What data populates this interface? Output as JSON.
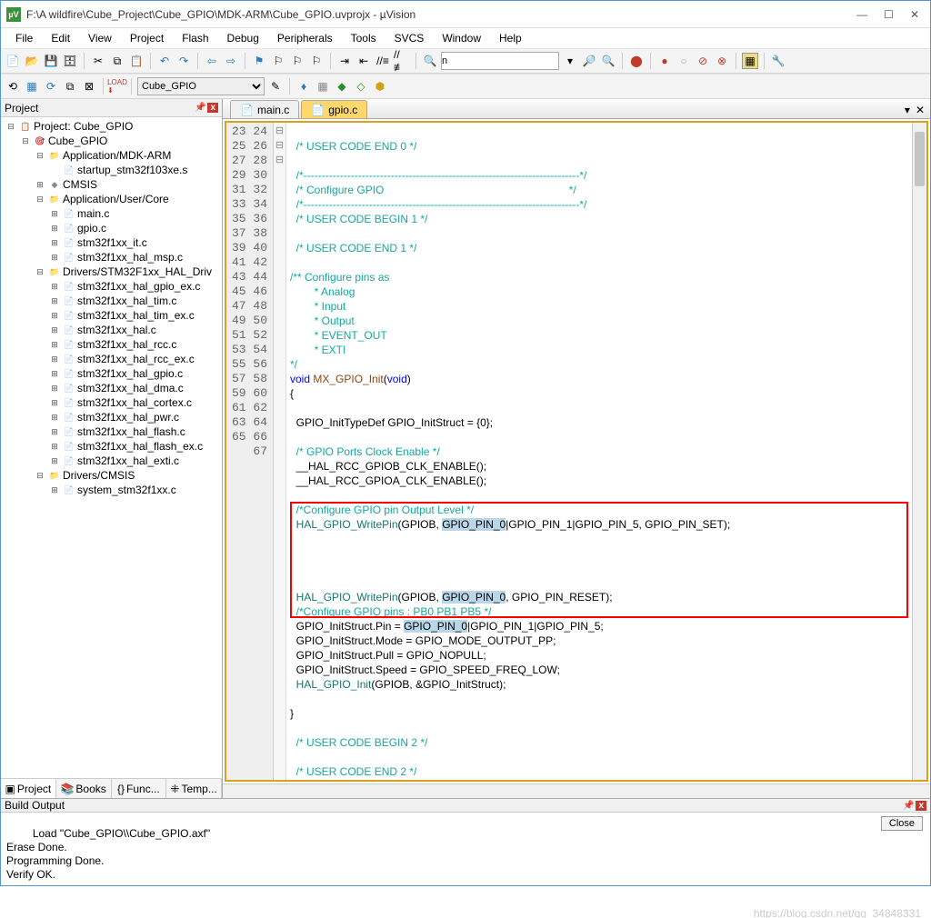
{
  "titlebar": {
    "icon_label": "µV",
    "title": "F:\\A wildfire\\Cube_Project\\Cube_GPIO\\MDK-ARM\\Cube_GPIO.uvprojx - µVision"
  },
  "menus": [
    "File",
    "Edit",
    "View",
    "Project",
    "Flash",
    "Debug",
    "Peripherals",
    "Tools",
    "SVCS",
    "Window",
    "Help"
  ],
  "toolbar2": {
    "target": "Cube_GPIO"
  },
  "search_box": "n",
  "project_panel": {
    "title": "Project",
    "tabs": [
      "Project",
      "Books",
      "Func...",
      "Temp..."
    ],
    "tree": [
      {
        "indent": 0,
        "fold": "-",
        "icon": "proj",
        "label": "Project: Cube_GPIO"
      },
      {
        "indent": 1,
        "fold": "-",
        "icon": "target",
        "label": "Cube_GPIO"
      },
      {
        "indent": 2,
        "fold": "-",
        "icon": "folder",
        "label": "Application/MDK-ARM"
      },
      {
        "indent": 3,
        "fold": "",
        "icon": "file",
        "label": "startup_stm32f103xe.s"
      },
      {
        "indent": 2,
        "fold": "+",
        "icon": "diamond",
        "label": "CMSIS"
      },
      {
        "indent": 2,
        "fold": "-",
        "icon": "folder",
        "label": "Application/User/Core"
      },
      {
        "indent": 3,
        "fold": "+",
        "icon": "file",
        "label": "main.c"
      },
      {
        "indent": 3,
        "fold": "+",
        "icon": "file",
        "label": "gpio.c"
      },
      {
        "indent": 3,
        "fold": "+",
        "icon": "file",
        "label": "stm32f1xx_it.c"
      },
      {
        "indent": 3,
        "fold": "+",
        "icon": "file",
        "label": "stm32f1xx_hal_msp.c"
      },
      {
        "indent": 2,
        "fold": "-",
        "icon": "folder",
        "label": "Drivers/STM32F1xx_HAL_Driv"
      },
      {
        "indent": 3,
        "fold": "+",
        "icon": "file",
        "label": "stm32f1xx_hal_gpio_ex.c"
      },
      {
        "indent": 3,
        "fold": "+",
        "icon": "file",
        "label": "stm32f1xx_hal_tim.c"
      },
      {
        "indent": 3,
        "fold": "+",
        "icon": "file",
        "label": "stm32f1xx_hal_tim_ex.c"
      },
      {
        "indent": 3,
        "fold": "+",
        "icon": "file",
        "label": "stm32f1xx_hal.c"
      },
      {
        "indent": 3,
        "fold": "+",
        "icon": "file",
        "label": "stm32f1xx_hal_rcc.c"
      },
      {
        "indent": 3,
        "fold": "+",
        "icon": "file",
        "label": "stm32f1xx_hal_rcc_ex.c"
      },
      {
        "indent": 3,
        "fold": "+",
        "icon": "file",
        "label": "stm32f1xx_hal_gpio.c"
      },
      {
        "indent": 3,
        "fold": "+",
        "icon": "file",
        "label": "stm32f1xx_hal_dma.c"
      },
      {
        "indent": 3,
        "fold": "+",
        "icon": "file",
        "label": "stm32f1xx_hal_cortex.c"
      },
      {
        "indent": 3,
        "fold": "+",
        "icon": "file",
        "label": "stm32f1xx_hal_pwr.c"
      },
      {
        "indent": 3,
        "fold": "+",
        "icon": "file",
        "label": "stm32f1xx_hal_flash.c"
      },
      {
        "indent": 3,
        "fold": "+",
        "icon": "file",
        "label": "stm32f1xx_hal_flash_ex.c"
      },
      {
        "indent": 3,
        "fold": "+",
        "icon": "file",
        "label": "stm32f1xx_hal_exti.c"
      },
      {
        "indent": 2,
        "fold": "-",
        "icon": "folder",
        "label": "Drivers/CMSIS"
      },
      {
        "indent": 3,
        "fold": "+",
        "icon": "file",
        "label": "system_stm32f1xx.c"
      }
    ]
  },
  "editor": {
    "tabs": [
      {
        "name": "main.c",
        "active": false
      },
      {
        "name": "gpio.c",
        "active": true
      }
    ],
    "first_line": 23,
    "lines": [
      {
        "n": 23,
        "fold": "",
        "html": ""
      },
      {
        "n": 24,
        "fold": "",
        "html": "  <span class='c-comment'>/* USER CODE END 0 */</span>"
      },
      {
        "n": 25,
        "fold": "",
        "html": ""
      },
      {
        "n": 26,
        "fold": "⊟",
        "html": "  <span class='c-comment'>/*----------------------------------------------------------------------------*/</span>"
      },
      {
        "n": 27,
        "fold": "",
        "html": "  <span class='c-comment'>/* Configure GPIO                                                             */</span>"
      },
      {
        "n": 28,
        "fold": "",
        "html": "  <span class='c-comment'>/*----------------------------------------------------------------------------*/</span>"
      },
      {
        "n": 29,
        "fold": "",
        "html": "  <span class='c-comment'>/* USER CODE BEGIN 1 */</span>"
      },
      {
        "n": 30,
        "fold": "",
        "html": ""
      },
      {
        "n": 31,
        "fold": "",
        "html": "  <span class='c-comment'>/* USER CODE END 1 */</span>"
      },
      {
        "n": 32,
        "fold": "",
        "html": ""
      },
      {
        "n": 33,
        "fold": "⊟",
        "html": "<span class='c-comment'>/** Configure pins as</span>"
      },
      {
        "n": 34,
        "fold": "",
        "html": "<span class='c-comment'>        * Analog</span>"
      },
      {
        "n": 35,
        "fold": "",
        "html": "<span class='c-comment'>        * Input</span>"
      },
      {
        "n": 36,
        "fold": "",
        "html": "<span class='c-comment'>        * Output</span>"
      },
      {
        "n": 37,
        "fold": "",
        "html": "<span class='c-comment'>        * EVENT_OUT</span>"
      },
      {
        "n": 38,
        "fold": "",
        "html": "<span class='c-comment'>        * EXTI</span>"
      },
      {
        "n": 39,
        "fold": "",
        "html": "<span class='c-comment'>*/</span>"
      },
      {
        "n": 40,
        "fold": "",
        "html": "<span class='c-keyword'>void</span> <span class='c-funcdecl'>MX_GPIO_Init</span>(<span class='c-keyword'>void</span>)"
      },
      {
        "n": 41,
        "fold": "⊟",
        "html": "{"
      },
      {
        "n": 42,
        "fold": "",
        "html": ""
      },
      {
        "n": 43,
        "fold": "",
        "html": "  GPIO_InitTypeDef GPIO_InitStruct = {0};"
      },
      {
        "n": 44,
        "fold": "",
        "html": ""
      },
      {
        "n": 45,
        "fold": "",
        "html": "  <span class='c-comment'>/* GPIO Ports Clock Enable */</span>"
      },
      {
        "n": 46,
        "fold": "",
        "html": "  __HAL_RCC_GPIOB_CLK_ENABLE();"
      },
      {
        "n": 47,
        "fold": "",
        "html": "  __HAL_RCC_GPIOA_CLK_ENABLE();"
      },
      {
        "n": 48,
        "fold": "",
        "html": ""
      },
      {
        "n": 49,
        "fold": "",
        "html": "  <span class='c-comment'>/*Configure GPIO pin Output Level */</span>"
      },
      {
        "n": 50,
        "fold": "",
        "html": "  <span class='c-call'>HAL_GPIO_WritePin</span>(GPIOB, <span class='c-hl'>GPIO_PIN_0</span>|GPIO_PIN_1|GPIO_PIN_5, GPIO_PIN_SET);"
      },
      {
        "n": 51,
        "fold": "",
        "html": ""
      },
      {
        "n": 52,
        "fold": "",
        "html": ""
      },
      {
        "n": 53,
        "fold": "",
        "html": ""
      },
      {
        "n": 54,
        "fold": "",
        "html": ""
      },
      {
        "n": 55,
        "fold": "",
        "html": "  <span class='c-call'>HAL_GPIO_WritePin</span>(GPIOB, <span class='c-hl'>GPIO_PIN_0</span>, GPIO_PIN_RESET);"
      },
      {
        "n": 56,
        "fold": "",
        "html": "  <span class='c-comment'>/*Configure GPIO pins : PB0 PB1 PB5 */</span>"
      },
      {
        "n": 57,
        "fold": "",
        "html": "  GPIO_InitStruct.Pin = <span class='c-hl'>GPIO_PIN_0</span>|GPIO_PIN_1|GPIO_PIN_5;"
      },
      {
        "n": 58,
        "fold": "",
        "html": "  GPIO_InitStruct.Mode = GPIO_MODE_OUTPUT_PP;"
      },
      {
        "n": 59,
        "fold": "",
        "html": "  GPIO_InitStruct.Pull = GPIO_NOPULL;"
      },
      {
        "n": 60,
        "fold": "",
        "html": "  GPIO_InitStruct.Speed = GPIO_SPEED_FREQ_LOW;"
      },
      {
        "n": 61,
        "fold": "",
        "html": "  <span class='c-call'>HAL_GPIO_Init</span>(GPIOB, &amp;GPIO_InitStruct);"
      },
      {
        "n": 62,
        "fold": "",
        "html": ""
      },
      {
        "n": 63,
        "fold": "",
        "html": "}"
      },
      {
        "n": 64,
        "fold": "",
        "html": ""
      },
      {
        "n": 65,
        "fold": "",
        "html": "  <span class='c-comment'>/* USER CODE BEGIN 2 */</span>"
      },
      {
        "n": 66,
        "fold": "",
        "html": ""
      },
      {
        "n": 67,
        "fold": "",
        "html": "  <span class='c-comment'>/* USER CODE END 2 */</span>"
      }
    ]
  },
  "build_output": {
    "title": "Build Output",
    "close_label": "Close",
    "text": "Load \"Cube_GPIO\\\\Cube_GPIO.axf\"\nErase Done.\nProgramming Done.\nVerify OK.",
    "watermark": "https://blog.csdn.net/qq_34848331"
  }
}
